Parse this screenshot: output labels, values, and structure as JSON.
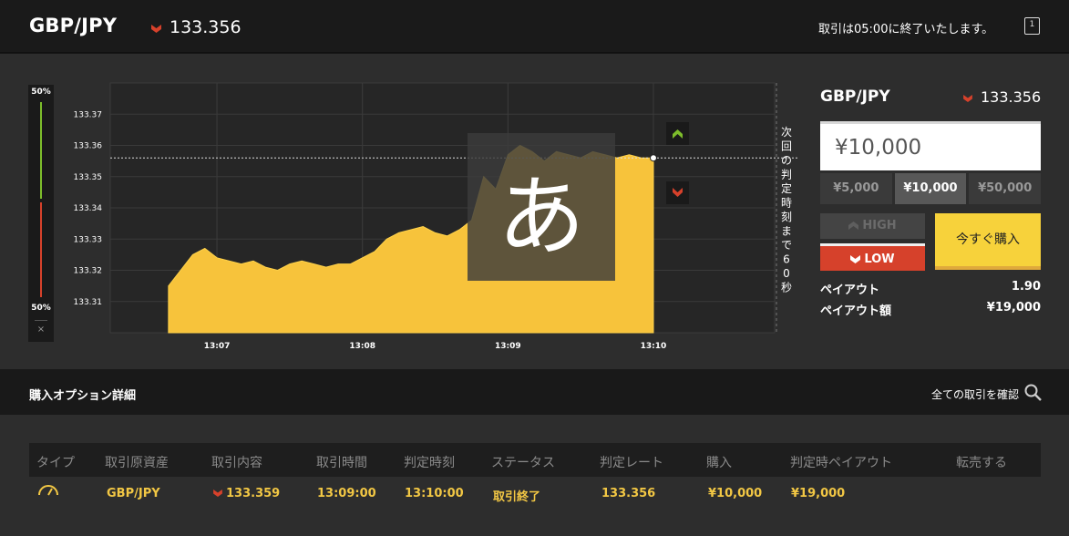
{
  "header": {
    "pair": "GBP/JPY",
    "price": "133.356",
    "notice": "取引は05:00に終了いたします。",
    "window_icon": "1"
  },
  "gauge": {
    "top_pct": "50%",
    "bottom_pct": "50%",
    "close": "×"
  },
  "chart_data": {
    "type": "area",
    "title": "",
    "xlabel": "",
    "ylabel": "",
    "x_ticks": [
      "13:07",
      "13:08",
      "13:09",
      "13:10"
    ],
    "y_ticks": [
      "133.37",
      "133.36",
      "133.35",
      "133.34",
      "133.33",
      "133.32",
      "133.31"
    ],
    "ylim": [
      133.3,
      133.38
    ],
    "current_rate": 133.356,
    "countdown_label": "次回の判定時刻まで60秒",
    "overlay_glyph": "あ",
    "series": [
      {
        "color": "#f7c33b",
        "x": [
          "13:06:40",
          "13:06:45",
          "13:06:50",
          "13:06:55",
          "13:07:00",
          "13:07:05",
          "13:07:10",
          "13:07:15",
          "13:07:20",
          "13:07:25",
          "13:07:30",
          "13:07:35",
          "13:07:40",
          "13:07:45",
          "13:07:50",
          "13:07:55",
          "13:08:00",
          "13:08:05",
          "13:08:10",
          "13:08:15",
          "13:08:20",
          "13:08:25",
          "13:08:30",
          "13:08:35",
          "13:08:40",
          "13:08:45",
          "13:08:50",
          "13:08:55",
          "13:09:00",
          "13:09:05",
          "13:09:10",
          "13:09:15",
          "13:09:20",
          "13:09:25",
          "13:09:30",
          "13:09:35",
          "13:09:40",
          "13:09:45",
          "13:09:50",
          "13:09:55",
          "13:10:00"
        ],
        "values": [
          133.315,
          133.32,
          133.325,
          133.327,
          133.324,
          133.323,
          133.322,
          133.323,
          133.321,
          133.32,
          133.322,
          133.323,
          133.322,
          133.321,
          133.322,
          133.322,
          133.324,
          133.326,
          133.33,
          133.332,
          133.333,
          133.334,
          133.332,
          133.331,
          133.333,
          133.336,
          133.35,
          133.346,
          133.357,
          133.36,
          133.358,
          133.355,
          133.358,
          133.357,
          133.356,
          133.358,
          133.357,
          133.356,
          133.357,
          133.356,
          133.356
        ]
      }
    ],
    "markers": [
      {
        "type": "high-arrow",
        "color": "#7dbd2b"
      },
      {
        "type": "low-arrow",
        "color": "#d6412b"
      }
    ]
  },
  "panel": {
    "pair": "GBP/JPY",
    "price": "133.356",
    "amount": "¥10,000",
    "presets": [
      "¥5,000",
      "¥10,000",
      "¥50,000"
    ],
    "high_label": "HIGH",
    "low_label": "LOW",
    "buy_label": "今すぐ購入",
    "payout_label": "ペイアウト",
    "payout_value": "1.90",
    "payout_amount_label": "ペイアウト額",
    "payout_amount_value": "¥19,000"
  },
  "options": {
    "title": "購入オプション詳細",
    "all_trades_link": "全ての取引を確認"
  },
  "table": {
    "columns": [
      "タイプ",
      "取引原資産",
      "取引内容",
      "取引時間",
      "判定時刻",
      "ステータス",
      "判定レート",
      "購入",
      "判定時ペイアウト",
      "転売する"
    ],
    "row": {
      "asset": "GBP/JPY",
      "content": "133.359",
      "trade_time": "13:09:00",
      "judge_time": "13:10:00",
      "status": "取引終了",
      "judge_rate": "133.356",
      "purchase": "¥10,000",
      "payout": "¥19,000"
    }
  },
  "colors": {
    "up": "#7dbd2b",
    "down": "#d6412b",
    "accent_yellow": "#f7d23b",
    "text_yellow": "#f2c744"
  }
}
